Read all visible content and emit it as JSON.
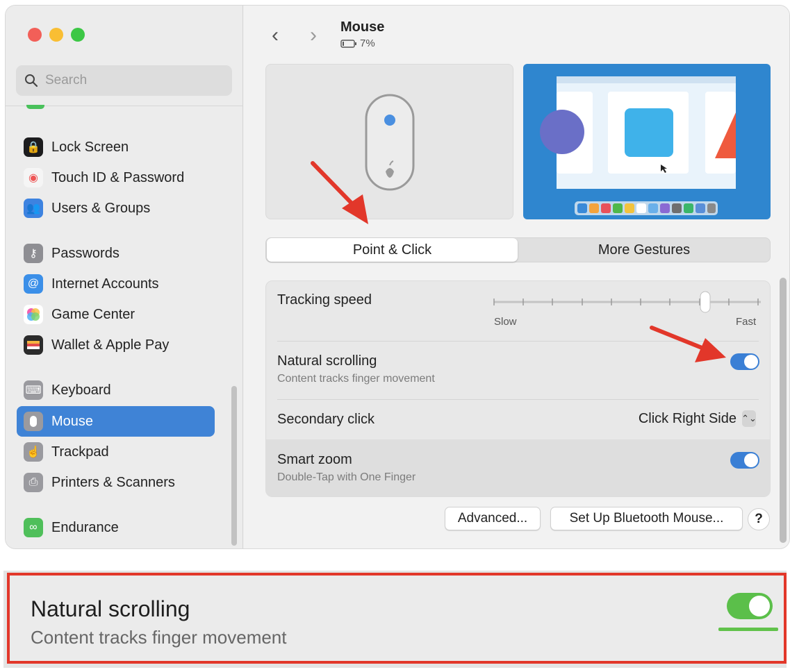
{
  "search": {
    "placeholder": "Search"
  },
  "sidebar": {
    "items": [
      {
        "label": "Lock Screen",
        "icon": "lock-icon",
        "color": "#1c1c1e"
      },
      {
        "label": "Touch ID & Password",
        "icon": "fingerprint-icon",
        "color": "#f05a5a"
      },
      {
        "label": "Users & Groups",
        "icon": "users-icon",
        "color": "#3d83e0"
      },
      {
        "label": "Passwords",
        "icon": "key-icon",
        "color": "#8e8e93"
      },
      {
        "label": "Internet Accounts",
        "icon": "at-icon",
        "color": "#3b8fe8"
      },
      {
        "label": "Game Center",
        "icon": "game-center-icon",
        "color": "#e8a33a"
      },
      {
        "label": "Wallet & Apple Pay",
        "icon": "wallet-icon",
        "color": "#2b2b2b"
      },
      {
        "label": "Keyboard",
        "icon": "keyboard-icon",
        "color": "#8e8e93"
      },
      {
        "label": "Mouse",
        "icon": "mouse-icon",
        "color": "#8e8e93",
        "selected": true
      },
      {
        "label": "Trackpad",
        "icon": "trackpad-icon",
        "color": "#8e8e93"
      },
      {
        "label": "Printers & Scanners",
        "icon": "printer-icon",
        "color": "#8e8e93"
      },
      {
        "label": "Endurance",
        "icon": "endurance-icon",
        "color": "#4fbf5a"
      }
    ]
  },
  "header": {
    "title": "Mouse",
    "battery": "7%"
  },
  "tabs": {
    "active": "Point & Click",
    "other": "More Gestures"
  },
  "settings": {
    "tracking_speed": {
      "label": "Tracking speed",
      "slow": "Slow",
      "fast": "Fast",
      "level": 0.8
    },
    "natural_scrolling": {
      "label": "Natural scrolling",
      "sub": "Content tracks finger movement",
      "on": true
    },
    "secondary_click": {
      "label": "Secondary click",
      "value": "Click Right Side"
    },
    "smart_zoom": {
      "label": "Smart zoom",
      "sub": "Double-Tap with One Finger",
      "on": true
    }
  },
  "buttons": {
    "advanced": "Advanced...",
    "bluetooth": "Set Up Bluetooth Mouse...",
    "help": "?"
  },
  "zoom": {
    "title": "Natural scrolling",
    "sub": "Content tracks finger movement",
    "on": true
  },
  "colors": {
    "accent": "#3f83d6",
    "annotation": "#e2372a",
    "toggle_on_zoom": "#5bbf4a"
  }
}
